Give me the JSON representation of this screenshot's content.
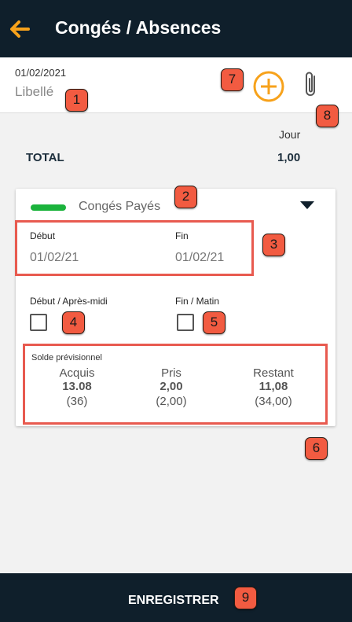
{
  "header": {
    "title": "Congés / Absences",
    "back_icon": "arrow-left-icon"
  },
  "topbar": {
    "date": "01/02/2021",
    "label": "Libellé",
    "add_icon": "plus-circle-icon",
    "attach_icon": "paperclip-icon"
  },
  "summary": {
    "column_header": "Jour",
    "total_label": "TOTAL",
    "total_value": "1,00"
  },
  "card": {
    "type_label": "Congés Payés",
    "type_color": "#1bb33c",
    "start_label": "Début",
    "start_value": "01/02/21",
    "end_label": "Fin",
    "end_value": "01/02/21",
    "start_option_label": "Début / Après-midi",
    "end_option_label": "Fin / Matin",
    "solde_title": "Solde prévisionnel",
    "solde": [
      {
        "heading": "Acquis",
        "value": "13.08",
        "projection": "(36)"
      },
      {
        "heading": "Pris",
        "value": "2,00",
        "projection": "(2,00)"
      },
      {
        "heading": "Restant",
        "value": "11,08",
        "projection": "(34,00)"
      }
    ]
  },
  "badges": [
    "1",
    "2",
    "3",
    "4",
    "5",
    "6",
    "7",
    "8",
    "9"
  ],
  "footer": {
    "save_label": "ENREGISTRER"
  },
  "colors": {
    "accent": "#f7a21b",
    "header_bg": "#0f1f2b",
    "highlight": "#e85a4f"
  }
}
